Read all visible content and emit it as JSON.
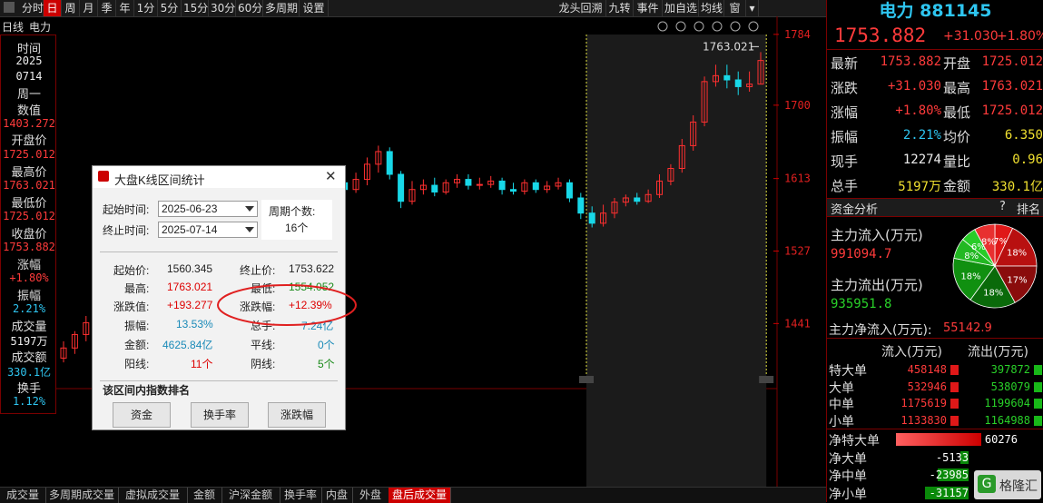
{
  "toolbar": {
    "items": [
      "分时",
      "日",
      "周",
      "月",
      "季",
      "年",
      "1分",
      "5分",
      "15分",
      "30分",
      "60分",
      "多周期",
      "设置"
    ],
    "active": "日",
    "right_items": [
      "龙头回溯",
      "九转",
      "事件",
      "加自选",
      "均线",
      "窗"
    ]
  },
  "chart_header": {
    "period": "日线",
    "name": "电力"
  },
  "left_panel": {
    "time_label": "时间",
    "year": "2025",
    "date": "0714",
    "weekday": "周一",
    "value_label": "数值",
    "value": "1403.272",
    "open_label": "开盘价",
    "open": "1725.012",
    "high_label": "最高价",
    "high": "1763.021",
    "low_label": "最低价",
    "low": "1725.012",
    "close_label": "收盘价",
    "close": "1753.882",
    "chg_label": "涨幅",
    "chg": "+1.80%",
    "amp_label": "振幅",
    "amp": "2.21%",
    "vol_label": "成交量",
    "vol": "5197万",
    "amt_label": "成交额",
    "amt": "330.1亿",
    "turn_label": "换手",
    "turn": "1.12%"
  },
  "chart_data": {
    "type": "candlestick",
    "y_ticks": [
      "1784",
      "1700",
      "1613",
      "1527",
      "1441"
    ],
    "high_marker": "1763.021",
    "candles": [
      {
        "o": 1400,
        "c": 1412,
        "h": 1420,
        "l": 1395
      },
      {
        "o": 1412,
        "c": 1428,
        "h": 1432,
        "l": 1405
      },
      {
        "o": 1428,
        "c": 1442,
        "h": 1450,
        "l": 1420
      },
      {
        "o": 1442,
        "c": 1436,
        "h": 1452,
        "l": 1428
      },
      {
        "o": 1436,
        "c": 1458,
        "h": 1462,
        "l": 1430
      },
      {
        "o": 1458,
        "c": 1470,
        "h": 1478,
        "l": 1440
      },
      {
        "o": 1470,
        "c": 1455,
        "h": 1476,
        "l": 1396
      },
      {
        "o": 1455,
        "c": 1478,
        "h": 1482,
        "l": 1450
      },
      {
        "o": 1478,
        "c": 1498,
        "h": 1502,
        "l": 1470
      },
      {
        "o": 1498,
        "c": 1505,
        "h": 1512,
        "l": 1490
      },
      {
        "o": 1505,
        "c": 1526,
        "h": 1532,
        "l": 1498
      },
      {
        "o": 1526,
        "c": 1532,
        "h": 1540,
        "l": 1518
      },
      {
        "o": 1532,
        "c": 1548,
        "h": 1552,
        "l": 1526
      },
      {
        "o": 1548,
        "c": 1530,
        "h": 1552,
        "l": 1525
      },
      {
        "o": 1530,
        "c": 1545,
        "h": 1550,
        "l": 1525
      },
      {
        "o": 1545,
        "c": 1565,
        "h": 1570,
        "l": 1538
      },
      {
        "o": 1565,
        "c": 1590,
        "h": 1600,
        "l": 1560
      },
      {
        "o": 1590,
        "c": 1612,
        "h": 1618,
        "l": 1585
      },
      {
        "o": 1612,
        "c": 1580,
        "h": 1616,
        "l": 1572
      },
      {
        "o": 1580,
        "c": 1596,
        "h": 1605,
        "l": 1575
      },
      {
        "o": 1596,
        "c": 1600,
        "h": 1610,
        "l": 1590
      },
      {
        "o": 1600,
        "c": 1592,
        "h": 1608,
        "l": 1585
      },
      {
        "o": 1592,
        "c": 1605,
        "h": 1612,
        "l": 1588
      },
      {
        "o": 1605,
        "c": 1598,
        "h": 1612,
        "l": 1592
      },
      {
        "o": 1598,
        "c": 1608,
        "h": 1614,
        "l": 1594
      },
      {
        "o": 1608,
        "c": 1600,
        "h": 1616,
        "l": 1596
      },
      {
        "o": 1600,
        "c": 1612,
        "h": 1620,
        "l": 1596
      },
      {
        "o": 1612,
        "c": 1630,
        "h": 1638,
        "l": 1605
      },
      {
        "o": 1630,
        "c": 1645,
        "h": 1652,
        "l": 1620
      },
      {
        "o": 1645,
        "c": 1618,
        "h": 1650,
        "l": 1612
      },
      {
        "o": 1618,
        "c": 1586,
        "h": 1622,
        "l": 1578
      },
      {
        "o": 1586,
        "c": 1600,
        "h": 1610,
        "l": 1582
      },
      {
        "o": 1600,
        "c": 1605,
        "h": 1612,
        "l": 1594
      },
      {
        "o": 1605,
        "c": 1597,
        "h": 1614,
        "l": 1592
      },
      {
        "o": 1597,
        "c": 1608,
        "h": 1612,
        "l": 1594
      },
      {
        "o": 1608,
        "c": 1612,
        "h": 1618,
        "l": 1602
      },
      {
        "o": 1612,
        "c": 1605,
        "h": 1618,
        "l": 1600
      },
      {
        "o": 1605,
        "c": 1606,
        "h": 1614,
        "l": 1600
      },
      {
        "o": 1606,
        "c": 1610,
        "h": 1616,
        "l": 1602
      },
      {
        "o": 1610,
        "c": 1600,
        "h": 1614,
        "l": 1594
      },
      {
        "o": 1600,
        "c": 1598,
        "h": 1608,
        "l": 1594
      },
      {
        "o": 1598,
        "c": 1608,
        "h": 1612,
        "l": 1594
      },
      {
        "o": 1608,
        "c": 1600,
        "h": 1612,
        "l": 1596
      },
      {
        "o": 1600,
        "c": 1604,
        "h": 1610,
        "l": 1596
      },
      {
        "o": 1604,
        "c": 1608,
        "h": 1614,
        "l": 1600
      },
      {
        "o": 1608,
        "c": 1590,
        "h": 1612,
        "l": 1585
      },
      {
        "o": 1590,
        "c": 1572,
        "h": 1596,
        "l": 1565
      },
      {
        "o": 1572,
        "c": 1560,
        "h": 1580,
        "l": 1555
      },
      {
        "o": 1560,
        "c": 1572,
        "h": 1582,
        "l": 1556
      },
      {
        "o": 1572,
        "c": 1585,
        "h": 1590,
        "l": 1566
      },
      {
        "o": 1585,
        "c": 1590,
        "h": 1594,
        "l": 1580
      },
      {
        "o": 1590,
        "c": 1586,
        "h": 1596,
        "l": 1582
      },
      {
        "o": 1586,
        "c": 1594,
        "h": 1600,
        "l": 1584
      },
      {
        "o": 1594,
        "c": 1610,
        "h": 1618,
        "l": 1590
      },
      {
        "o": 1610,
        "c": 1625,
        "h": 1630,
        "l": 1605
      },
      {
        "o": 1625,
        "c": 1652,
        "h": 1660,
        "l": 1620
      },
      {
        "o": 1652,
        "c": 1680,
        "h": 1688,
        "l": 1646
      },
      {
        "o": 1680,
        "c": 1728,
        "h": 1734,
        "l": 1675
      },
      {
        "o": 1728,
        "c": 1735,
        "h": 1748,
        "l": 1722
      },
      {
        "o": 1735,
        "c": 1730,
        "h": 1748,
        "l": 1720
      },
      {
        "o": 1730,
        "c": 1722,
        "h": 1740,
        "l": 1712
      },
      {
        "o": 1722,
        "c": 1725,
        "h": 1740,
        "l": 1716
      },
      {
        "o": 1725,
        "c": 1753,
        "h": 1763,
        "l": 1725
      }
    ]
  },
  "dialog": {
    "title": "大盘K线区间统计",
    "start_label": "起始时间:",
    "start": "2025-06-23",
    "end_label": "终止时间:",
    "end": "2025-07-14",
    "period_label": "周期个数:",
    "period": "16个",
    "start_price_label": "起始价:",
    "start_price": "1560.345",
    "end_price_label": "终止价:",
    "end_price": "1753.622",
    "high_label": "最高:",
    "high": "1763.021",
    "low_label": "最低:",
    "low": "1554.052",
    "chg_val_label": "涨跌值:",
    "chg_val": "+193.277",
    "chg_pct_label": "涨跌幅:",
    "chg_pct": "+12.39%",
    "amp_label": "振幅:",
    "amp": "13.53%",
    "total_label": "总手:",
    "total": "7.24亿",
    "amount_label": "金额:",
    "amount": "4625.84亿",
    "flat_label": "平线:",
    "flat": "0个",
    "up_label": "阳线:",
    "up": "11个",
    "down_label": "阴线:",
    "down": "5个",
    "rank_title": "该区间内指数排名",
    "btn_fund": "资金",
    "btn_turnover": "换手率",
    "btn_chg": "涨跌幅"
  },
  "right_panel": {
    "name": "电力 881145",
    "price": "1753.882",
    "chg": "+31.030",
    "pct": "+1.80%",
    "rows": [
      {
        "l1": "最新",
        "v1": "1753.882",
        "c1": "red",
        "l2": "开盘",
        "v2": "1725.012",
        "c2": "red"
      },
      {
        "l1": "涨跌",
        "v1": "+31.030",
        "c1": "red",
        "l2": "最高",
        "v2": "1763.021",
        "c2": "red"
      },
      {
        "l1": "涨幅",
        "v1": "+1.80%",
        "c1": "red",
        "l2": "最低",
        "v2": "1725.012",
        "c2": "red"
      },
      {
        "l1": "振幅",
        "v1": "2.21%",
        "c1": "cyan",
        "l2": "均价",
        "v2": "6.350",
        "c2": "yellow"
      },
      {
        "l1": "现手",
        "v1": "12274",
        "c1": "white",
        "l2": "量比",
        "v2": "0.96",
        "c2": "yellow"
      },
      {
        "l1": "总手",
        "v1": "5197万",
        "c1": "yellow",
        "l2": "金额",
        "v2": "330.1亿",
        "c2": "yellow"
      }
    ],
    "fund_header": "资金分析",
    "fund_q": "?",
    "fund_rank": "排名",
    "inflow_label": "主力流入(万元)",
    "inflow": "991094.7",
    "outflow_label": "主力流出(万元)",
    "outflow": "935951.8",
    "net_label": "主力净流入(万元):",
    "net": "55142.9",
    "pie": [
      {
        "pct": 7,
        "label": "7%",
        "color": "#e01818"
      },
      {
        "pct": 18,
        "label": "18%",
        "color": "#b81010"
      },
      {
        "pct": 17,
        "label": "17%",
        "color": "#8a0c0c"
      },
      {
        "pct": 18,
        "label": "18%",
        "color": "#0a6a0a"
      },
      {
        "pct": 18,
        "label": "18%",
        "color": "#109010"
      },
      {
        "pct": 8,
        "label": "8%",
        "color": "#22b822"
      },
      {
        "pct": 6,
        "label": "6%",
        "color": "#28cc28"
      },
      {
        "pct": 8,
        "label": "8%",
        "color": "#e83030"
      }
    ],
    "flow_in_header": "流入(万元)",
    "flow_out_header": "流出(万元)",
    "flows": [
      {
        "name": "特大单",
        "in": "458148",
        "out": "397872"
      },
      {
        "name": "大单",
        "in": "532946",
        "out": "538079"
      },
      {
        "name": "中单",
        "in": "1175619",
        "out": "1199604"
      },
      {
        "name": "小单",
        "in": "1133830",
        "out": "1164988"
      }
    ],
    "nets": [
      {
        "name": "净特大单",
        "val": "60276",
        "color": "red",
        "frac": 0.55
      },
      {
        "name": "净大单",
        "val": "-5133",
        "color": "green",
        "frac": 0.05
      },
      {
        "name": "净中单",
        "val": "-23985",
        "color": "green",
        "frac": 0.2
      },
      {
        "name": "净小单",
        "val": "-31157",
        "color": "green",
        "frac": 0.28
      }
    ],
    "watermark": "格隆汇"
  },
  "bottom_tabs": [
    "成交量",
    "多周期成交量",
    "虚拟成交量",
    "金额",
    "沪深金额",
    "换手率",
    "内盘",
    "外盘",
    "盘后成交量"
  ],
  "bottom_active": "盘后成交量"
}
